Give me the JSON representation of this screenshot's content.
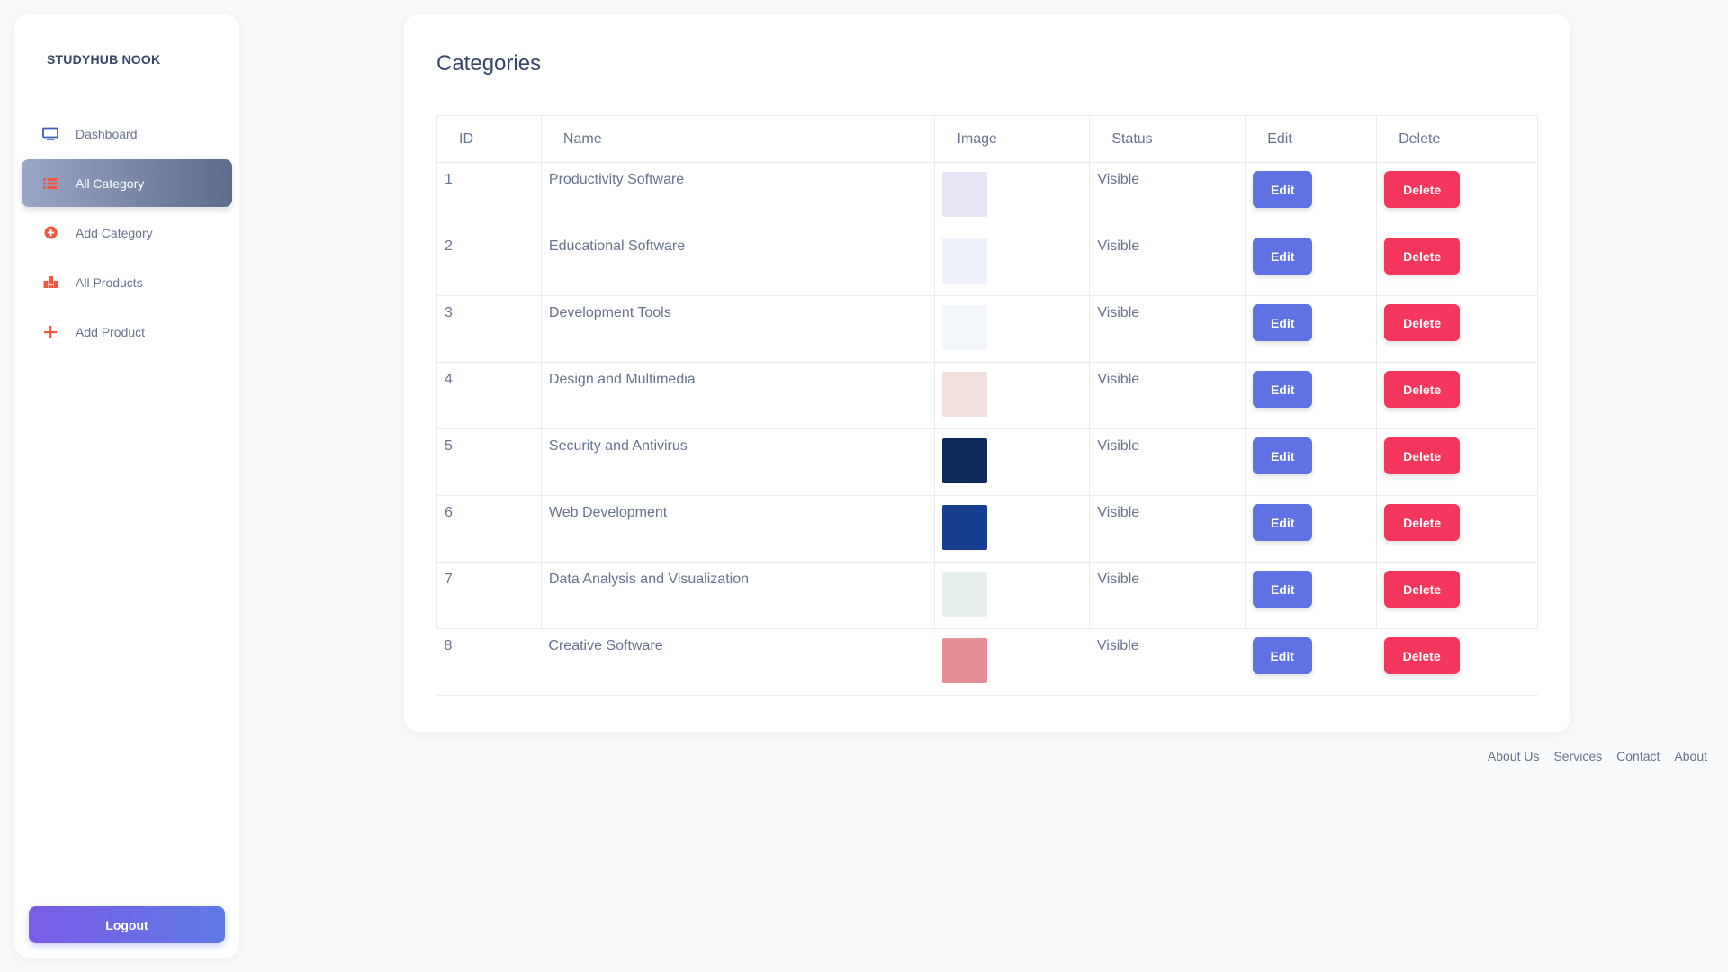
{
  "brand": "STUDYHUB NOOK",
  "sidebar": {
    "items": [
      {
        "label": "Dashboard",
        "icon": "monitor-icon"
      },
      {
        "label": "All Category",
        "icon": "list-icon",
        "active": true
      },
      {
        "label": "Add Category",
        "icon": "plus-circle-icon"
      },
      {
        "label": "All Products",
        "icon": "boxes-icon"
      },
      {
        "label": "Add Product",
        "icon": "plus-icon"
      }
    ],
    "logout_label": "Logout"
  },
  "page": {
    "title": "Categories"
  },
  "table": {
    "headers": [
      "ID",
      "Name",
      "Image",
      "Status",
      "Edit",
      "Delete"
    ],
    "rows": [
      {
        "id": "1",
        "name": "Productivity Software",
        "status": "Visible",
        "edit": "Edit",
        "delete": "Delete",
        "thumb": "#e8e4f5"
      },
      {
        "id": "2",
        "name": "Educational Software",
        "status": "Visible",
        "edit": "Edit",
        "delete": "Delete",
        "thumb": "#eef0fa"
      },
      {
        "id": "3",
        "name": "Development Tools",
        "status": "Visible",
        "edit": "Edit",
        "delete": "Delete",
        "thumb": "#f3f6fb"
      },
      {
        "id": "4",
        "name": "Design and Multimedia",
        "status": "Visible",
        "edit": "Edit",
        "delete": "Delete",
        "thumb": "#f3dede"
      },
      {
        "id": "5",
        "name": "Security and Antivirus",
        "status": "Visible",
        "edit": "Edit",
        "delete": "Delete",
        "thumb": "#0b2a5a"
      },
      {
        "id": "6",
        "name": "Web Development",
        "status": "Visible",
        "edit": "Edit",
        "delete": "Delete",
        "thumb": "#163e8e"
      },
      {
        "id": "7",
        "name": "Data Analysis and Visualization",
        "status": "Visible",
        "edit": "Edit",
        "delete": "Delete",
        "thumb": "#e6efec"
      },
      {
        "id": "8",
        "name": "Creative Software",
        "status": "Visible",
        "edit": "Edit",
        "delete": "Delete",
        "thumb": "#e48f95"
      }
    ]
  },
  "footer": {
    "links": [
      "About Us",
      "Services",
      "Contact",
      "About"
    ]
  },
  "colors": {
    "edit": "#5e72e4",
    "delete": "#f5365c",
    "icon_accent": "#f5563e",
    "icon_blue": "#3d5cb6"
  }
}
